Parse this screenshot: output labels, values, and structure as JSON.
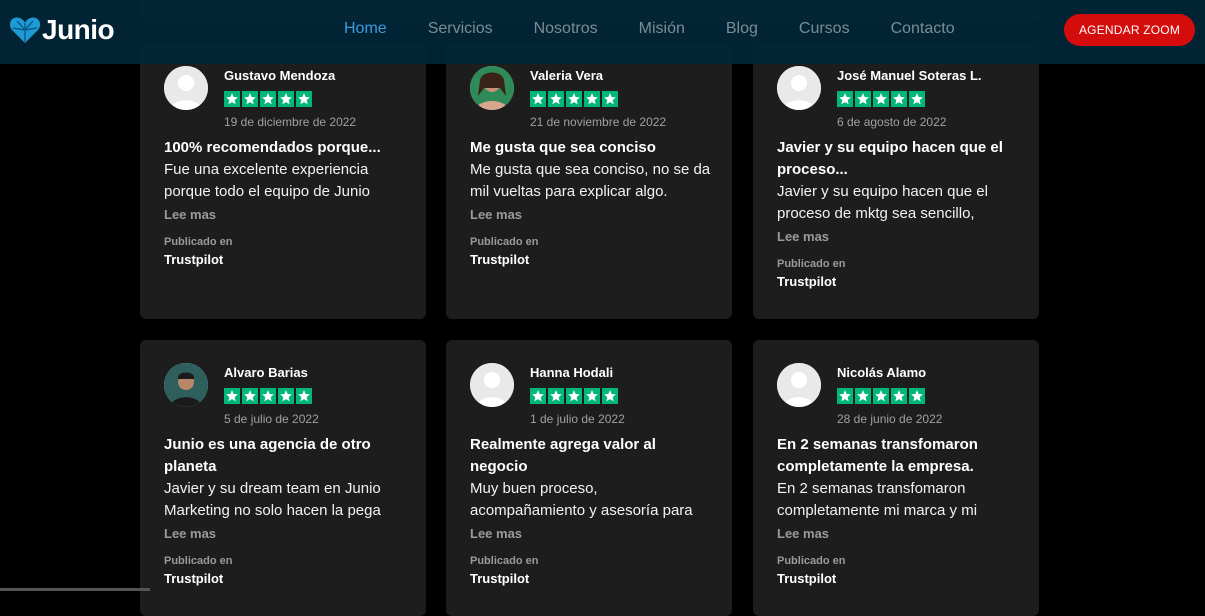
{
  "brand": {
    "name": "Junio",
    "accent": "#1e9bd7"
  },
  "nav": {
    "items": [
      {
        "label": "Home",
        "active": true
      },
      {
        "label": "Servicios"
      },
      {
        "label": "Nosotros"
      },
      {
        "label": "Misión"
      },
      {
        "label": "Blog"
      },
      {
        "label": "Cursos"
      },
      {
        "label": "Contacto"
      }
    ],
    "cta": "AGENDAR ZOOM"
  },
  "reviews": [
    {
      "name": "Gustavo Mendoza",
      "avatar": "default-avatar",
      "rating": 5,
      "date": "19 de diciembre de 2022",
      "title": "100% recomendados porque...",
      "body": "Fue una excelente experiencia porque todo el equipo de Junio",
      "more": "Lee mas",
      "published_label": "Publicado en",
      "source": "Trustpilot"
    },
    {
      "name": "Valeria Vera",
      "avatar": "photo-avatar",
      "rating": 5,
      "date": "21 de noviembre de 2022",
      "title": "Me gusta que sea conciso",
      "body": "Me gusta que sea conciso, no se da mil vueltas para explicar algo.",
      "more": "Lee mas",
      "published_label": "Publicado en",
      "source": "Trustpilot"
    },
    {
      "name": "José Manuel Soteras L.",
      "avatar": "default-avatar",
      "rating": 5,
      "date": "6 de agosto de 2022",
      "title": "Javier y su equipo hacen que el proceso...",
      "body": "Javier y su equipo hacen que el proceso de mktg sea sencillo,",
      "more": "Lee mas",
      "published_label": "Publicado en",
      "source": "Trustpilot"
    },
    {
      "name": "Alvaro Barias",
      "avatar": "photo-avatar",
      "rating": 5,
      "date": "5 de julio de 2022",
      "title": "Junio es una agencia de otro planeta",
      "body": "Javier y su dream team en Junio Marketing no solo hacen la pega",
      "more": "Lee mas",
      "published_label": "Publicado en",
      "source": "Trustpilot"
    },
    {
      "name": "Hanna Hodali",
      "avatar": "default-avatar",
      "rating": 5,
      "date": "1 de julio de 2022",
      "title": "Realmente agrega valor al negocio",
      "body": "Muy buen proceso, acompañamiento y asesoría para",
      "more": "Lee mas",
      "published_label": "Publicado en",
      "source": "Trustpilot"
    },
    {
      "name": "Nicolás Alamo",
      "avatar": "default-avatar",
      "rating": 5,
      "date": "28 de junio de 2022",
      "title": "En 2 semanas transfomaron completamente la empresa.",
      "body": "En 2 semanas transfomaron completamente mi marca y mi",
      "more": "Lee mas",
      "published_label": "Publicado en",
      "source": "Trustpilot"
    }
  ],
  "colors": {
    "star": "#00b67a",
    "cta": "#d40c0c",
    "nav_active": "#3d9be0",
    "card": "#1d1d1d"
  }
}
